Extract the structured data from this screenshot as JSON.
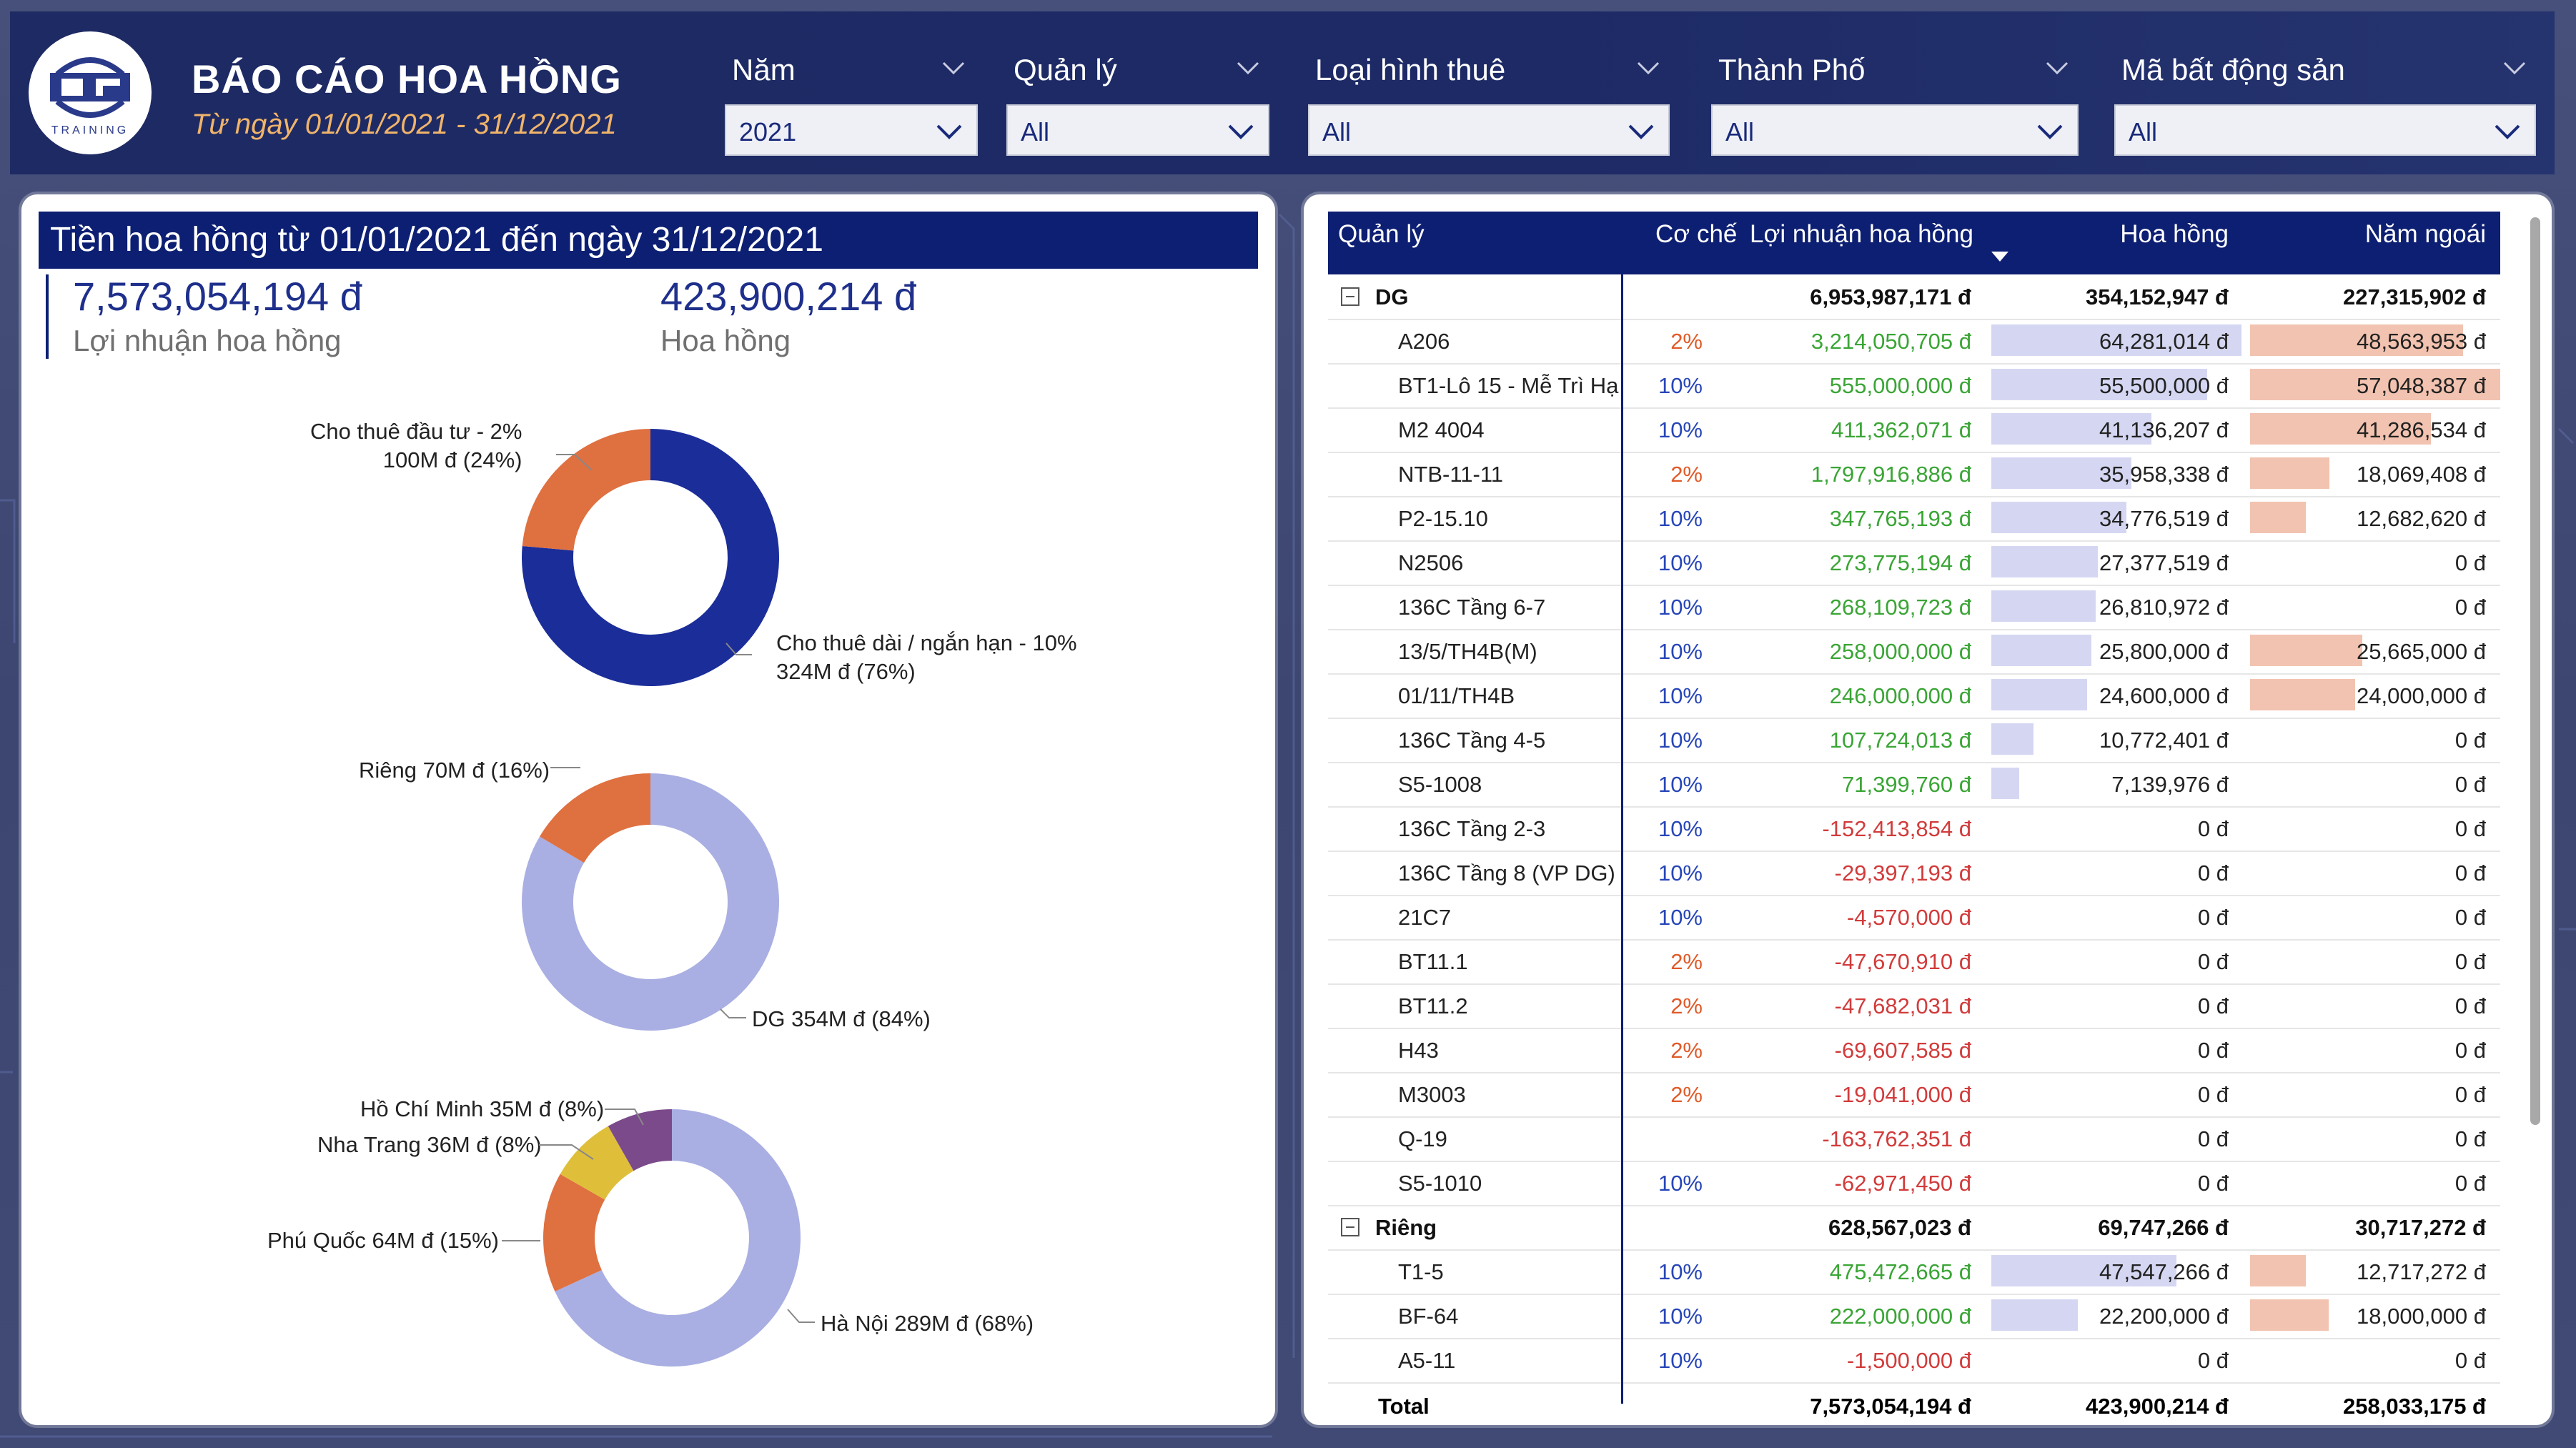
{
  "header": {
    "title": "BÁO CÁO HOA HỒNG",
    "subtitle": "Từ ngày 01/01/2021 - 31/12/2021",
    "logo_text": "TRAINING"
  },
  "filters": [
    {
      "label": "Năm",
      "value": "2021"
    },
    {
      "label": "Quản lý",
      "value": "All"
    },
    {
      "label": "Loại hình thuê",
      "value": "All"
    },
    {
      "label": "Thành Phố",
      "value": "All"
    },
    {
      "label": "Mã bất động sản",
      "value": "All"
    }
  ],
  "left": {
    "section_title": "Tiền hoa hồng từ 01/01/2021 đến ngày 31/12/2021",
    "kpis": [
      {
        "value": "7,573,054,194 đ",
        "label": "Lợi nhuận hoa hồng"
      },
      {
        "value": "423,900,214 đ",
        "label": "Hoa hồng"
      }
    ]
  },
  "chart_data": [
    {
      "type": "pie",
      "donut": true,
      "slices": [
        {
          "label": "Cho thuê dài / ngắn hạn - 10%",
          "display": "324M đ (76%)",
          "value": 324,
          "percent": 76,
          "color": "#1a2d99"
        },
        {
          "label": "Cho thuê đầu tư - 2%",
          "display": "100M đ (24%)",
          "value": 100,
          "percent": 24,
          "color": "#df7040"
        }
      ]
    },
    {
      "type": "pie",
      "donut": true,
      "slices": [
        {
          "label": "DG",
          "display": "354M đ (84%)",
          "value": 354,
          "percent": 84,
          "color": "#a9afe2"
        },
        {
          "label": "Riêng",
          "display": "70M đ (16%)",
          "value": 70,
          "percent": 16,
          "color": "#df7040"
        }
      ]
    },
    {
      "type": "pie",
      "donut": true,
      "slices": [
        {
          "label": "Hà Nội",
          "display": "289M đ (68%)",
          "value": 289,
          "percent": 68,
          "color": "#a9afe2"
        },
        {
          "label": "Phú Quốc",
          "display": "64M đ (15%)",
          "value": 64,
          "percent": 15,
          "color": "#df7040"
        },
        {
          "label": "Nha Trang",
          "display": "36M đ (8%)",
          "value": 36,
          "percent": 8,
          "color": "#dfbf3a"
        },
        {
          "label": "Hồ Chí Minh",
          "display": "35M đ (8%)",
          "value": 35,
          "percent": 8,
          "color": "#7b4a8a"
        }
      ]
    }
  ],
  "table": {
    "headers": [
      "Quản lý",
      "Cơ chế",
      "Lợi nhuận hoa hồng",
      "Hoa hồng",
      "Năm ngoái"
    ],
    "rows": [
      {
        "type": "group",
        "name": "DG",
        "rate": "",
        "profit": "6,953,987,171 đ",
        "comm": "354,152,947 đ",
        "prev": "227,315,902 đ",
        "comm_v": 0,
        "prev_v": 0
      },
      {
        "type": "item",
        "name": "A206",
        "rate": "2%",
        "profit": "3,214,050,705 đ",
        "comm": "64,281,014 đ",
        "prev": "48,563,953 đ",
        "comm_v": 64281014,
        "prev_v": 48563953
      },
      {
        "type": "item",
        "name": "BT1-Lô 15 - Mễ Trì Hạ",
        "rate": "10%",
        "profit": "555,000,000 đ",
        "comm": "55,500,000 đ",
        "prev": "57,048,387 đ",
        "comm_v": 55500000,
        "prev_v": 57048387
      },
      {
        "type": "item",
        "name": "M2 4004",
        "rate": "10%",
        "profit": "411,362,071 đ",
        "comm": "41,136,207 đ",
        "prev": "41,286,534 đ",
        "comm_v": 41136207,
        "prev_v": 41286534
      },
      {
        "type": "item",
        "name": "NTB-11-11",
        "rate": "2%",
        "profit": "1,797,916,886 đ",
        "comm": "35,958,338 đ",
        "prev": "18,069,408 đ",
        "comm_v": 35958338,
        "prev_v": 18069408
      },
      {
        "type": "item",
        "name": "P2-15.10",
        "rate": "10%",
        "profit": "347,765,193 đ",
        "comm": "34,776,519 đ",
        "prev": "12,682,620 đ",
        "comm_v": 34776519,
        "prev_v": 12682620
      },
      {
        "type": "item",
        "name": "N2506",
        "rate": "10%",
        "profit": "273,775,194 đ",
        "comm": "27,377,519 đ",
        "prev": "0 đ",
        "comm_v": 27377519,
        "prev_v": 0
      },
      {
        "type": "item",
        "name": "136C Tầng 6-7",
        "rate": "10%",
        "profit": "268,109,723 đ",
        "comm": "26,810,972 đ",
        "prev": "0 đ",
        "comm_v": 26810972,
        "prev_v": 0
      },
      {
        "type": "item",
        "name": "13/5/TH4B(M)",
        "rate": "10%",
        "profit": "258,000,000 đ",
        "comm": "25,800,000 đ",
        "prev": "25,665,000 đ",
        "comm_v": 25800000,
        "prev_v": 25665000
      },
      {
        "type": "item",
        "name": "01/11/TH4B",
        "rate": "10%",
        "profit": "246,000,000 đ",
        "comm": "24,600,000 đ",
        "prev": "24,000,000 đ",
        "comm_v": 24600000,
        "prev_v": 24000000
      },
      {
        "type": "item",
        "name": "136C Tầng 4-5",
        "rate": "10%",
        "profit": "107,724,013 đ",
        "comm": "10,772,401 đ",
        "prev": "0 đ",
        "comm_v": 10772401,
        "prev_v": 0
      },
      {
        "type": "item",
        "name": "S5-1008",
        "rate": "10%",
        "profit": "71,399,760 đ",
        "comm": "7,139,976 đ",
        "prev": "0 đ",
        "comm_v": 7139976,
        "prev_v": 0
      },
      {
        "type": "item",
        "name": "136C Tầng 2-3",
        "rate": "10%",
        "profit": "-152,413,854 đ",
        "comm": "0 đ",
        "prev": "0 đ",
        "comm_v": 0,
        "prev_v": 0
      },
      {
        "type": "item",
        "name": "136C Tầng 8 (VP DG)",
        "rate": "10%",
        "profit": "-29,397,193 đ",
        "comm": "0 đ",
        "prev": "0 đ",
        "comm_v": 0,
        "prev_v": 0
      },
      {
        "type": "item",
        "name": "21C7",
        "rate": "10%",
        "profit": "-4,570,000 đ",
        "comm": "0 đ",
        "prev": "0 đ",
        "comm_v": 0,
        "prev_v": 0
      },
      {
        "type": "item",
        "name": "BT11.1",
        "rate": "2%",
        "profit": "-47,670,910 đ",
        "comm": "0 đ",
        "prev": "0 đ",
        "comm_v": 0,
        "prev_v": 0
      },
      {
        "type": "item",
        "name": "BT11.2",
        "rate": "2%",
        "profit": "-47,682,031 đ",
        "comm": "0 đ",
        "prev": "0 đ",
        "comm_v": 0,
        "prev_v": 0
      },
      {
        "type": "item",
        "name": "H43",
        "rate": "2%",
        "profit": "-69,607,585 đ",
        "comm": "0 đ",
        "prev": "0 đ",
        "comm_v": 0,
        "prev_v": 0
      },
      {
        "type": "item",
        "name": "M3003",
        "rate": "2%",
        "profit": "-19,041,000 đ",
        "comm": "0 đ",
        "prev": "0 đ",
        "comm_v": 0,
        "prev_v": 0
      },
      {
        "type": "item",
        "name": "Q-19",
        "rate": "",
        "profit": "-163,762,351 đ",
        "comm": "0 đ",
        "prev": "0 đ",
        "comm_v": 0,
        "prev_v": 0
      },
      {
        "type": "item",
        "name": "S5-1010",
        "rate": "10%",
        "profit": "-62,971,450 đ",
        "comm": "0 đ",
        "prev": "0 đ",
        "comm_v": 0,
        "prev_v": 0
      },
      {
        "type": "group",
        "name": "Riêng",
        "rate": "",
        "profit": "628,567,023 đ",
        "comm": "69,747,266 đ",
        "prev": "30,717,272 đ",
        "comm_v": 0,
        "prev_v": 0
      },
      {
        "type": "item",
        "name": "T1-5",
        "rate": "10%",
        "profit": "475,472,665 đ",
        "comm": "47,547,266 đ",
        "prev": "12,717,272 đ",
        "comm_v": 47547266,
        "prev_v": 12717272
      },
      {
        "type": "item",
        "name": "BF-64",
        "rate": "10%",
        "profit": "222,000,000 đ",
        "comm": "22,200,000 đ",
        "prev": "18,000,000 đ",
        "comm_v": 22200000,
        "prev_v": 18000000
      },
      {
        "type": "item",
        "name": "A5-11",
        "rate": "10%",
        "profit": "-1,500,000 đ",
        "comm": "0 đ",
        "prev": "0 đ",
        "comm_v": 0,
        "prev_v": 0
      }
    ],
    "total": {
      "label": "Total",
      "profit": "7,573,054,194 đ",
      "comm": "423,900,214 đ",
      "prev": "258,033,175 đ"
    }
  }
}
